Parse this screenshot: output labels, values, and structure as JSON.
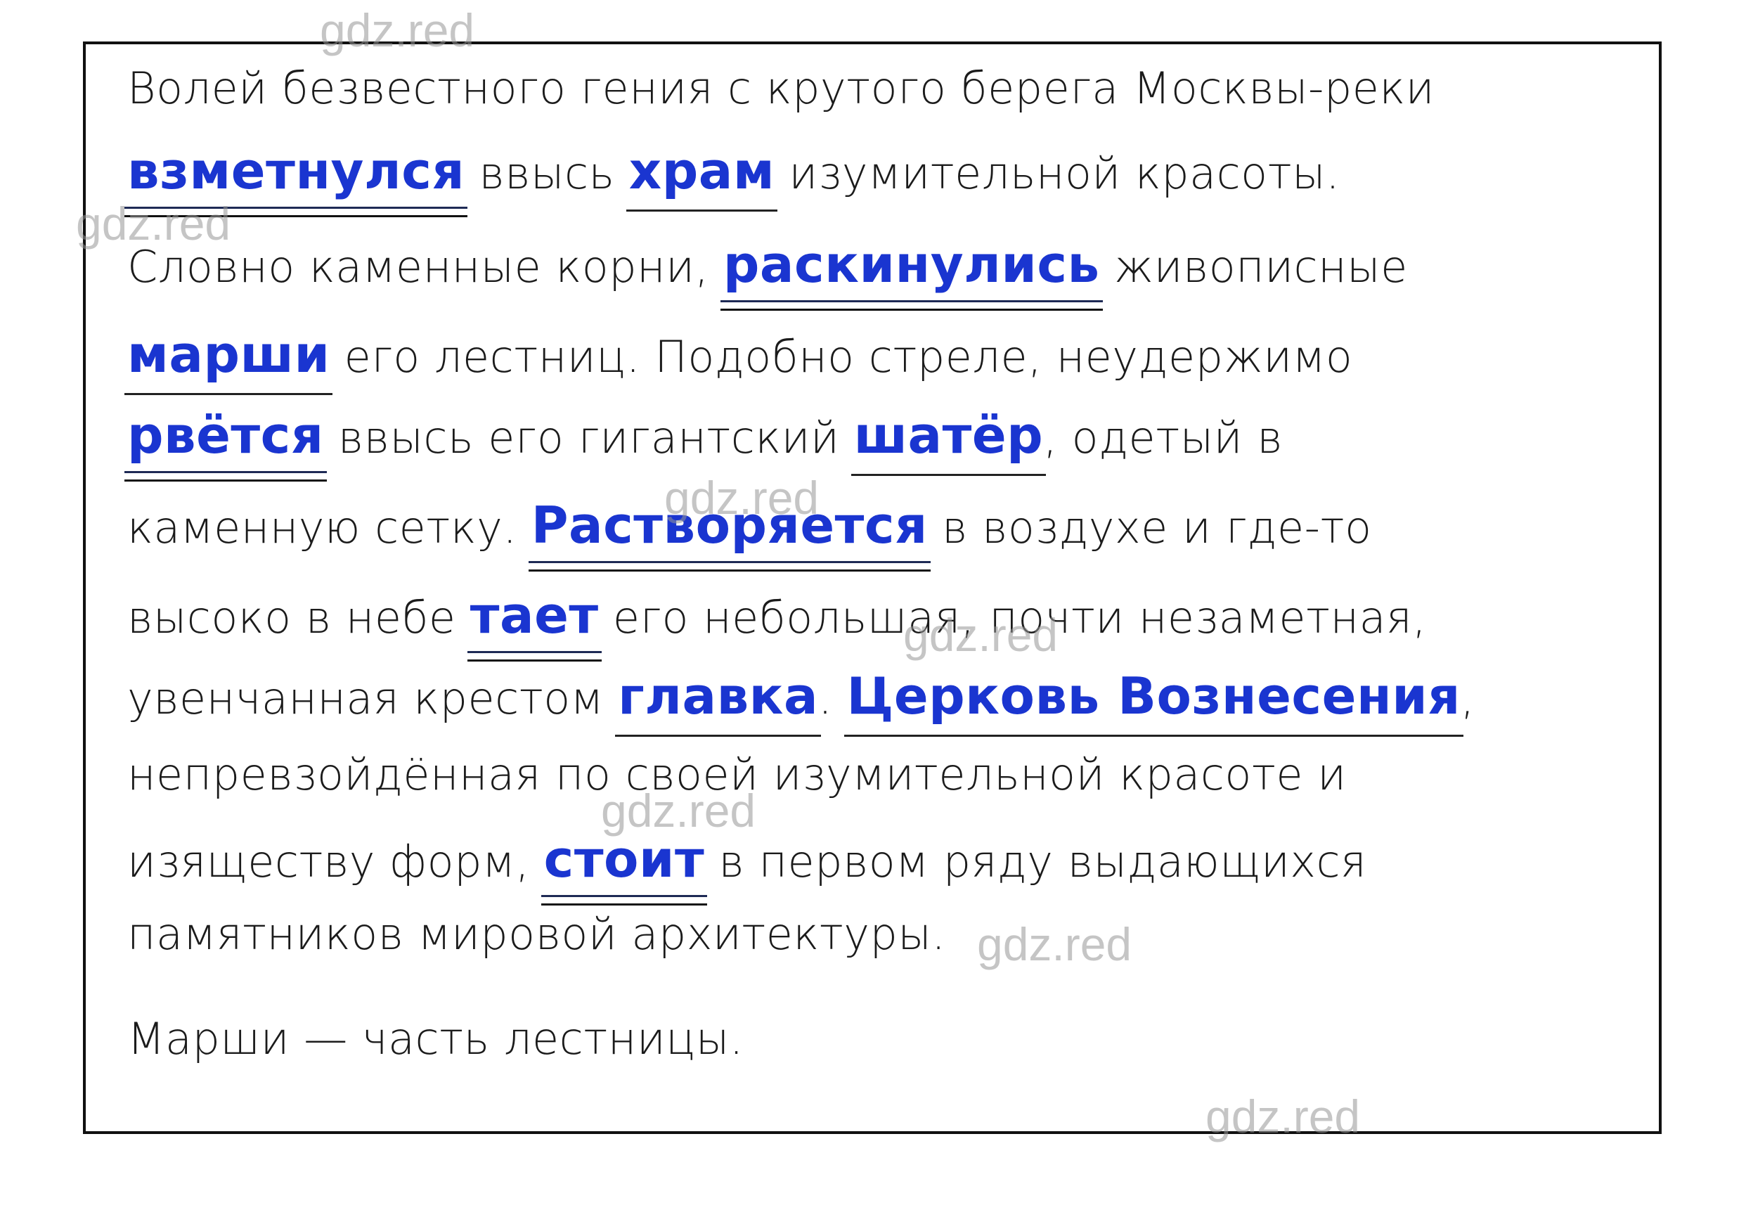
{
  "watermark": "gdz.red",
  "colors": {
    "highlight": "#1a35d0",
    "text": "#1b1b1b",
    "border": "#111111"
  },
  "lines": [
    {
      "parts": [
        {
          "t": "Волей безвестного гения с крутого берега Москвы-реки",
          "k": "plain"
        }
      ]
    },
    {
      "parts": [
        {
          "t": "взметнулся",
          "k": "pred"
        },
        {
          "t": " ввысь ",
          "k": "plain"
        },
        {
          "t": "храм",
          "k": "subj"
        },
        {
          "t": " изумительной красоты.",
          "k": "plain"
        }
      ]
    },
    {
      "parts": [
        {
          "t": "Словно каменные корни, ",
          "k": "plain"
        },
        {
          "t": "раскинулись",
          "k": "pred"
        },
        {
          "t": " живописные",
          "k": "plain"
        }
      ]
    },
    {
      "parts": [
        {
          "t": "марши",
          "k": "subj"
        },
        {
          "t": " его лестниц. Подобно стреле, неудержимо",
          "k": "plain"
        }
      ]
    },
    {
      "parts": [
        {
          "t": "рвётся",
          "k": "pred"
        },
        {
          "t": " ввысь его гигантский ",
          "k": "plain"
        },
        {
          "t": "шатёр",
          "k": "subj"
        },
        {
          "t": ", одетый в",
          "k": "plain"
        }
      ]
    },
    {
      "parts": [
        {
          "t": "каменную сетку. ",
          "k": "plain"
        },
        {
          "t": "Растворяется",
          "k": "pred"
        },
        {
          "t": " в воздухе и где-то",
          "k": "plain"
        }
      ]
    },
    {
      "parts": [
        {
          "t": "высоко в небе ",
          "k": "plain"
        },
        {
          "t": "тает",
          "k": "pred"
        },
        {
          "t": " его небольшая, почти незаметная,",
          "k": "plain"
        }
      ]
    },
    {
      "parts": [
        {
          "t": "увенчанная крестом ",
          "k": "plain"
        },
        {
          "t": "главка",
          "k": "subj"
        },
        {
          "t": ". ",
          "k": "plain"
        },
        {
          "t": "Церковь Вознесения",
          "k": "subj"
        },
        {
          "t": ",",
          "k": "plain"
        }
      ]
    },
    {
      "parts": [
        {
          "t": "непревзойдённая по своей изумительной красоте и",
          "k": "plain"
        }
      ]
    },
    {
      "parts": [
        {
          "t": "изяществу форм, ",
          "k": "plain"
        },
        {
          "t": "стоит",
          "k": "pred"
        },
        {
          "t": " в первом ряду выдающихся",
          "k": "plain"
        }
      ]
    },
    {
      "parts": [
        {
          "t": "памятников мировой архитектуры.",
          "k": "plain"
        }
      ]
    },
    {
      "parts": [
        {
          "t": "Марши — часть лестницы.",
          "k": "plain"
        }
      ]
    }
  ]
}
